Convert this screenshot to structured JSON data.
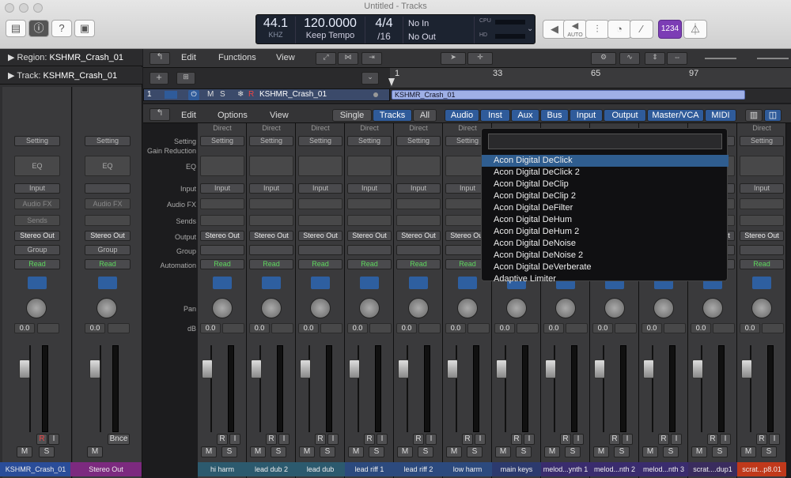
{
  "window": {
    "title": "Untitled - Tracks"
  },
  "lcd": {
    "sample_rate": "44.1",
    "sample_rate_unit": "KHZ",
    "tempo": "120.0000",
    "tempo_mode": "Keep Tempo",
    "sig_top": "4/4",
    "sig_bottom": "/16",
    "in": "No In",
    "out": "No Out",
    "cpu": "CPU",
    "hd": "HD"
  },
  "toolbar": {
    "auto": "AUTO",
    "count_in": "1234"
  },
  "inspector": {
    "region_label": "Region:",
    "region_name": "KSHMR_Crash_01",
    "track_label": "Track:",
    "track_name": "KSHMR_Crash_01"
  },
  "tracks_menu": {
    "edit": "Edit",
    "functions": "Functions",
    "view": "View"
  },
  "ruler": {
    "marks": [
      "1",
      "33",
      "65",
      "97"
    ]
  },
  "track_header": {
    "number": "1",
    "m": "M",
    "s": "S",
    "r": "R",
    "name": "KSHMR_Crash_01",
    "region": "KSHMR_Crash_01"
  },
  "mixer_menu": {
    "edit": "Edit",
    "options": "Options",
    "view": "View",
    "single": "Single",
    "tracks": "Tracks",
    "all": "All",
    "filters": [
      "Audio",
      "Inst",
      "Aux",
      "Bus",
      "Input",
      "Output",
      "Master/VCA",
      "MIDI"
    ]
  },
  "row_labels": {
    "setting": "Setting",
    "gain_reduction": "Gain Reduction",
    "eq": "EQ",
    "input": "Input",
    "audio_fx": "Audio FX",
    "sends": "Sends",
    "output": "Output",
    "group": "Group",
    "automation": "Automation",
    "pan": "Pan",
    "db": "dB"
  },
  "insp_strips": [
    {
      "setting": "Setting",
      "eq": "EQ",
      "input": "Input",
      "fx": "Audio FX",
      "sends": "Sends",
      "output": "Stereo Out",
      "group": "Group",
      "auto": "Read",
      "db": "0.0",
      "name": "KSHMR_Crash_01",
      "color": "#2a4d99",
      "r": "R",
      "i": "I",
      "m": "M",
      "s": "S"
    },
    {
      "setting": "Setting",
      "eq": "EQ",
      "input": "",
      "fx": "Audio FX",
      "sends": "",
      "output": "Stereo Out",
      "group": "Group",
      "auto": "Read",
      "db": "0.0",
      "name": "Stereo Out",
      "color": "#7c2a7f",
      "bnce": "Bnce",
      "m": "M"
    }
  ],
  "strips": [
    {
      "top": "Direct",
      "name": "hi harm",
      "color": "#2c5a6e"
    },
    {
      "top": "Direct",
      "name": "lead dub 2",
      "color": "#2c5a6e"
    },
    {
      "top": "Direct",
      "name": "lead dub",
      "color": "#2c5a6e"
    },
    {
      "top": "Direct",
      "name": "lead riff 1",
      "color": "#2c4a7e"
    },
    {
      "top": "Direct",
      "name": "lead riff 2",
      "color": "#2c4a7e"
    },
    {
      "top": "Direct",
      "name": "low harm",
      "color": "#2c4a7e"
    },
    {
      "top": "",
      "name": "main keys",
      "color": "#2c3a6e"
    },
    {
      "top": "",
      "name": "melod...ynth 1",
      "color": "#3a2c6e"
    },
    {
      "top": "",
      "name": "melod...nth 2",
      "color": "#3a2c6e"
    },
    {
      "top": "",
      "name": "melod...nth 3",
      "color": "#3a2c6e"
    },
    {
      "top": "",
      "name": "scrat....dup1",
      "color": "#3a2c5e"
    },
    {
      "top": "Direct",
      "name": "scrat...p8.01",
      "color": "#c0391b"
    }
  ],
  "strip_values": {
    "setting": "Setting",
    "input": "Input",
    "output": "Stereo Out",
    "auto": "Read",
    "db": "0.0",
    "r": "R",
    "i": "I",
    "m": "M",
    "s": "S"
  },
  "plugin_menu": {
    "search_value": "",
    "items": [
      "Acon Digital DeClick",
      "Acon Digital DeClick 2",
      "Acon Digital DeClip",
      "Acon Digital DeClip 2",
      "Acon Digital DeFilter",
      "Acon Digital DeHum",
      "Acon Digital DeHum 2",
      "Acon Digital DeNoise",
      "Acon Digital DeNoise 2",
      "Acon Digital DeVerberate",
      "Adaptive Limiter"
    ]
  },
  "colors": {
    "accent": "#2f5b9a",
    "read": "#5ed65e"
  }
}
